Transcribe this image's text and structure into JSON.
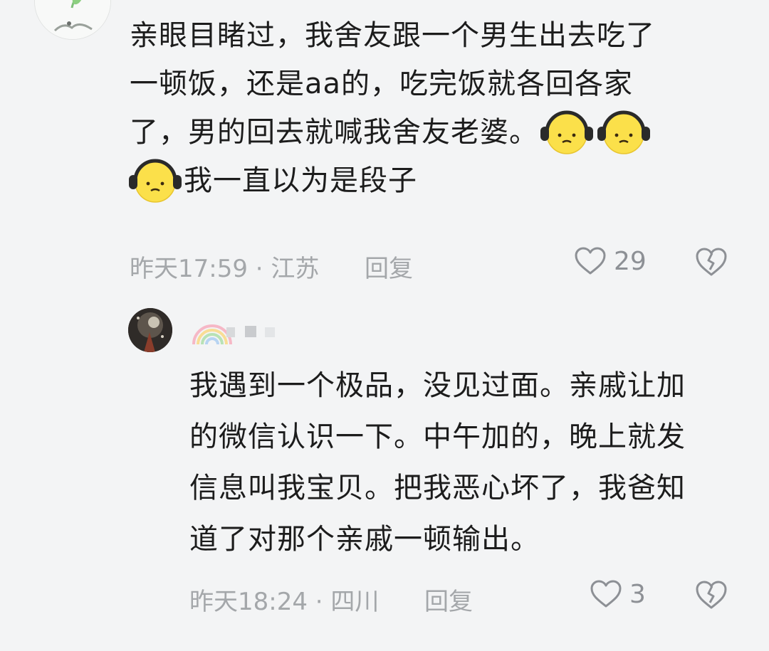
{
  "comment": {
    "text_lines": [
      "亲眼目睹过，我舍友跟一个男生出去吃了",
      "一顿饭，还是aa的，吃完饭就各回各家",
      "了，男的回去就喊我舍友老婆。"
    ],
    "text_after_emoji": "我一直以为是段子",
    "meta": "昨天17:59 · 江苏",
    "reply_label": "回复",
    "like_count": "29"
  },
  "reply": {
    "text_lines": [
      "我遇到一个极品，没见过面。亲戚让加",
      "的微信认识一下。中午加的，晚上就发",
      "信息叫我宝贝。把我恶心坏了，我爸知",
      "道了对那个亲戚一顿输出。"
    ],
    "meta": "昨天18:24 · 四川",
    "reply_label": "回复",
    "like_count": "3"
  },
  "colors": {
    "background": "#f3f4f5",
    "text": "#1c1c1c",
    "muted": "#a4a7aa",
    "icon": "#8d9095"
  },
  "icons": [
    "heart-icon",
    "broken-heart-icon",
    "headphone-face-emoji"
  ]
}
